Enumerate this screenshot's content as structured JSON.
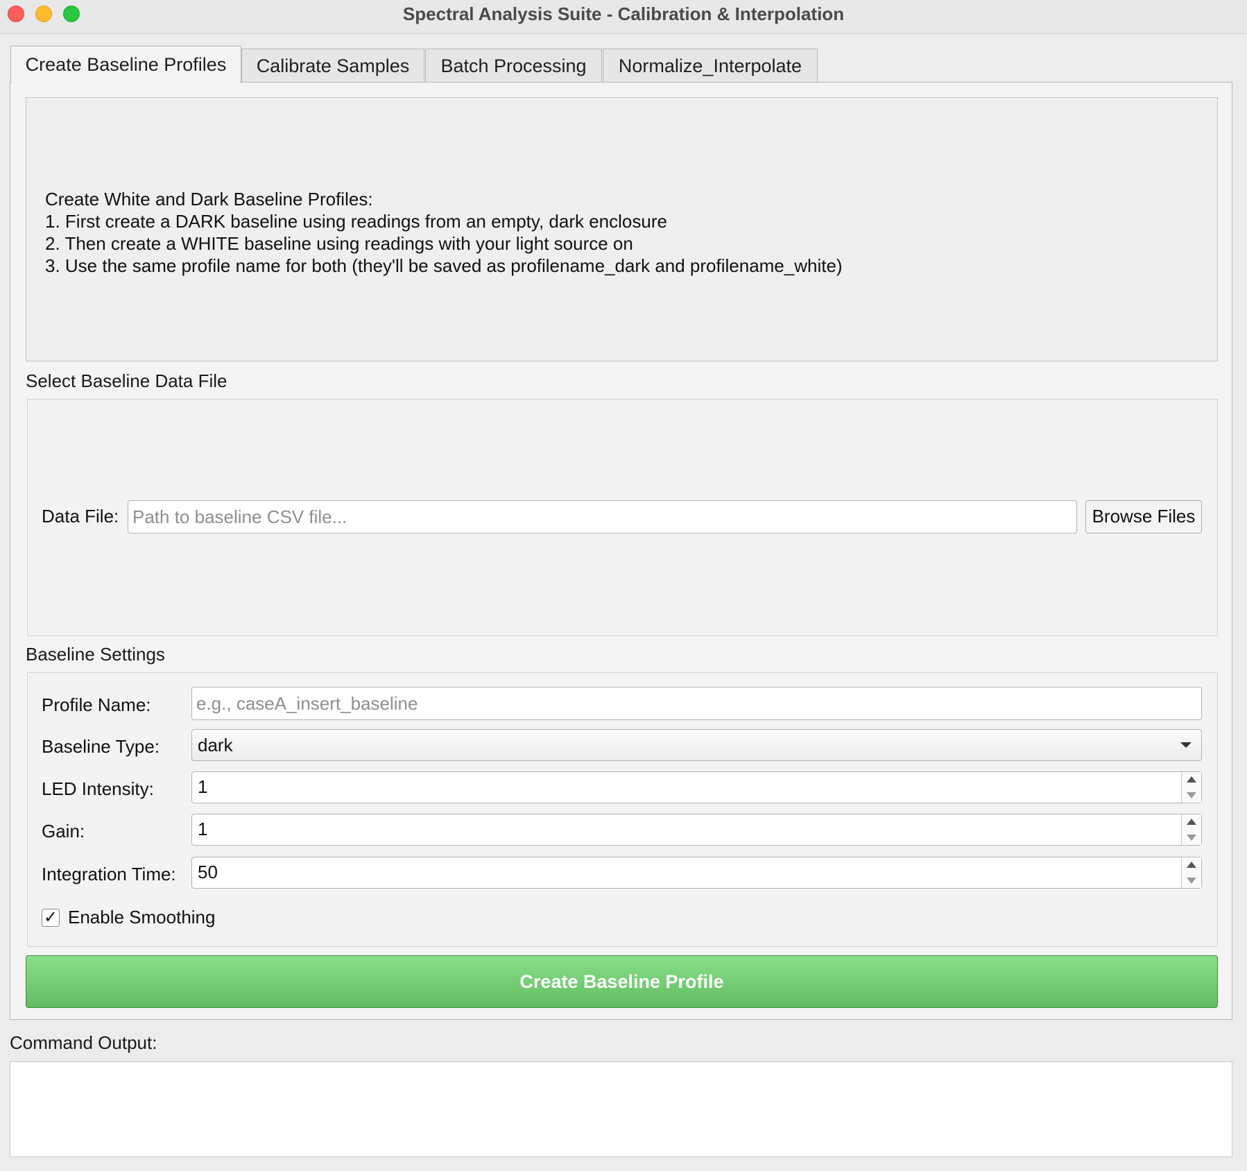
{
  "window": {
    "title": "Spectral Analysis Suite - Calibration & Interpolation"
  },
  "tabs": [
    {
      "label": "Create Baseline Profiles",
      "active": true
    },
    {
      "label": "Calibrate Samples",
      "active": false
    },
    {
      "label": "Batch Processing",
      "active": false
    },
    {
      "label": "Normalize_Interpolate",
      "active": false
    }
  ],
  "instructions": {
    "lines": [
      "Create White and Dark Baseline Profiles:",
      "1. First create a DARK baseline using readings from an empty, dark enclosure",
      "2. Then create a WHITE baseline using readings with your light source on",
      "3. Use the same profile name for both (they'll be saved as profilename_dark and profilename_white)"
    ]
  },
  "data_file": {
    "section_title": "Select Baseline Data File",
    "label": "Data File:",
    "value": "",
    "placeholder": "Path to baseline CSV file...",
    "browse_label": "Browse Files"
  },
  "settings": {
    "section_title": "Baseline Settings",
    "profile_name": {
      "label": "Profile Name:",
      "value": "",
      "placeholder": "e.g., caseA_insert_baseline"
    },
    "baseline_type": {
      "label": "Baseline Type:",
      "value": "dark"
    },
    "led_intensity": {
      "label": "LED Intensity:",
      "value": "1"
    },
    "gain": {
      "label": "Gain:",
      "value": "1"
    },
    "integration_time": {
      "label": "Integration Time:",
      "value": "50"
    },
    "smoothing": {
      "label": "Enable Smoothing",
      "checked": true,
      "check_glyph": "✓"
    }
  },
  "create_button": {
    "label": "Create Baseline Profile",
    "color": "#6fcc6f"
  },
  "output": {
    "label": "Command Output:",
    "text": ""
  },
  "colors": {
    "close": "#fe5f57",
    "minimize": "#febc2e",
    "maximize": "#28c840"
  }
}
